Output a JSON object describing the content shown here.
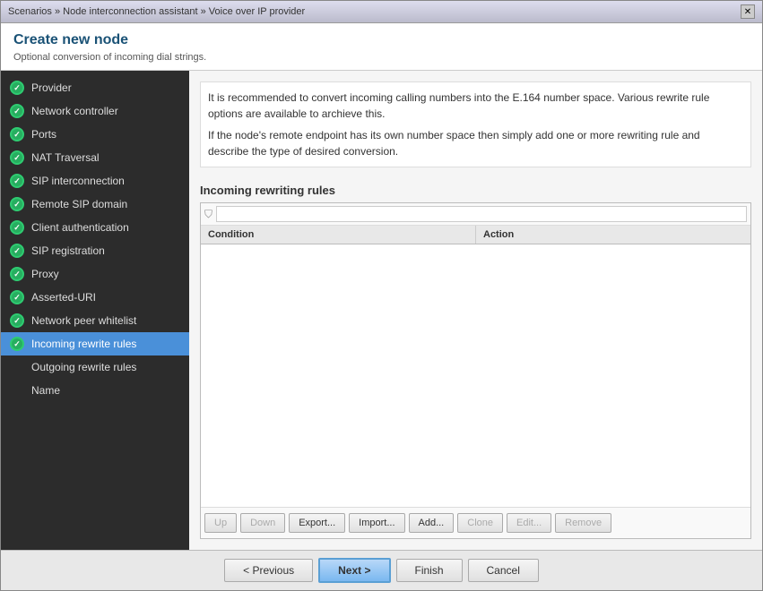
{
  "titlebar": {
    "text": "Scenarios » Node interconnection assistant » Voice over IP provider",
    "close_label": "✕"
  },
  "header": {
    "title": "Create new node",
    "subtitle": "Optional conversion of incoming dial strings."
  },
  "sidebar": {
    "items": [
      {
        "id": "provider",
        "label": "Provider",
        "checked": true,
        "active": false
      },
      {
        "id": "network-controller",
        "label": "Network controller",
        "checked": true,
        "active": false
      },
      {
        "id": "ports",
        "label": "Ports",
        "checked": true,
        "active": false
      },
      {
        "id": "nat-traversal",
        "label": "NAT Traversal",
        "checked": true,
        "active": false
      },
      {
        "id": "sip-interconnection",
        "label": "SIP interconnection",
        "checked": true,
        "active": false
      },
      {
        "id": "remote-sip-domain",
        "label": "Remote SIP domain",
        "checked": true,
        "active": false
      },
      {
        "id": "client-authentication",
        "label": "Client authentication",
        "checked": true,
        "active": false
      },
      {
        "id": "sip-registration",
        "label": "SIP registration",
        "checked": true,
        "active": false
      },
      {
        "id": "proxy",
        "label": "Proxy",
        "checked": true,
        "active": false
      },
      {
        "id": "asserted-uri",
        "label": "Asserted-URI",
        "checked": true,
        "active": false
      },
      {
        "id": "network-peer-whitelist",
        "label": "Network peer whitelist",
        "checked": true,
        "active": false
      },
      {
        "id": "incoming-rewrite-rules",
        "label": "Incoming rewrite rules",
        "checked": true,
        "active": true
      },
      {
        "id": "outgoing-rewrite-rules",
        "label": "Outgoing rewrite rules",
        "checked": false,
        "active": false
      },
      {
        "id": "name",
        "label": "Name",
        "checked": false,
        "active": false
      }
    ]
  },
  "content": {
    "description_line1": "It is recommended to convert incoming calling numbers into the E.164 number space. Various rewrite rule options are available to archieve this.",
    "description_line2": "If the node's remote endpoint has its own number space then simply add one or more rewriting rule and describe the type of desired conversion.",
    "section_title": "Incoming rewriting rules",
    "table": {
      "filter_placeholder": "",
      "columns": [
        "Condition",
        "Action"
      ],
      "rows": []
    },
    "buttons": {
      "up": "Up",
      "down": "Down",
      "export": "Export...",
      "import": "Import...",
      "add": "Add...",
      "clone": "Clone",
      "edit": "Edit...",
      "remove": "Remove"
    }
  },
  "footer": {
    "previous": "< Previous",
    "next": "Next >",
    "finish": "Finish",
    "cancel": "Cancel"
  }
}
